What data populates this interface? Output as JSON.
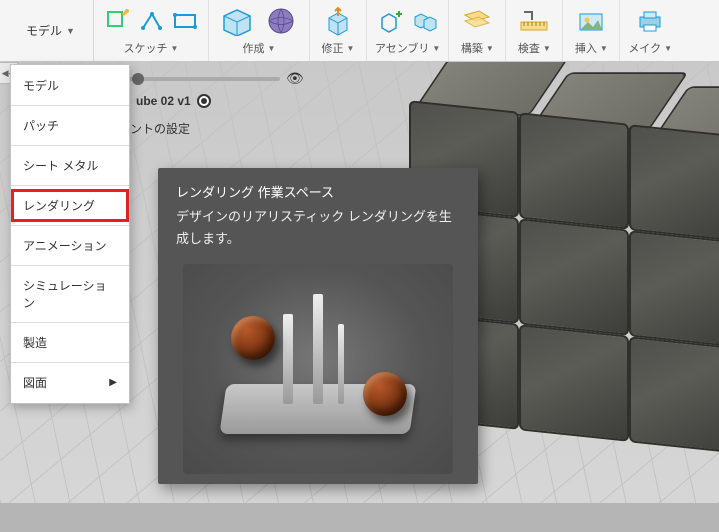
{
  "workspace": {
    "current": "モデル"
  },
  "toolbar": {
    "groups": [
      {
        "label": "スケッチ"
      },
      {
        "label": "作成"
      },
      {
        "label": "修正"
      },
      {
        "label": "アセンブリ"
      },
      {
        "label": "構築"
      },
      {
        "label": "検査"
      },
      {
        "label": "挿入"
      },
      {
        "label": "メイク"
      }
    ]
  },
  "browser": {
    "cube_label": "ube 02 v1",
    "settings_label": "ントの設定",
    "slider_icon": "eye"
  },
  "menu": {
    "items": [
      {
        "label": "モデル"
      },
      {
        "label": "パッチ"
      },
      {
        "label": "シート メタル"
      },
      {
        "label": "レンダリング",
        "highlight": true
      },
      {
        "label": "アニメーション"
      },
      {
        "label": "シミュレーション"
      },
      {
        "label": "製造"
      },
      {
        "label": "図面",
        "submenu": true
      }
    ]
  },
  "tooltip": {
    "title": "レンダリング 作業スペース",
    "body": "デザインのリアリスティック レンダリングを生成します。"
  }
}
